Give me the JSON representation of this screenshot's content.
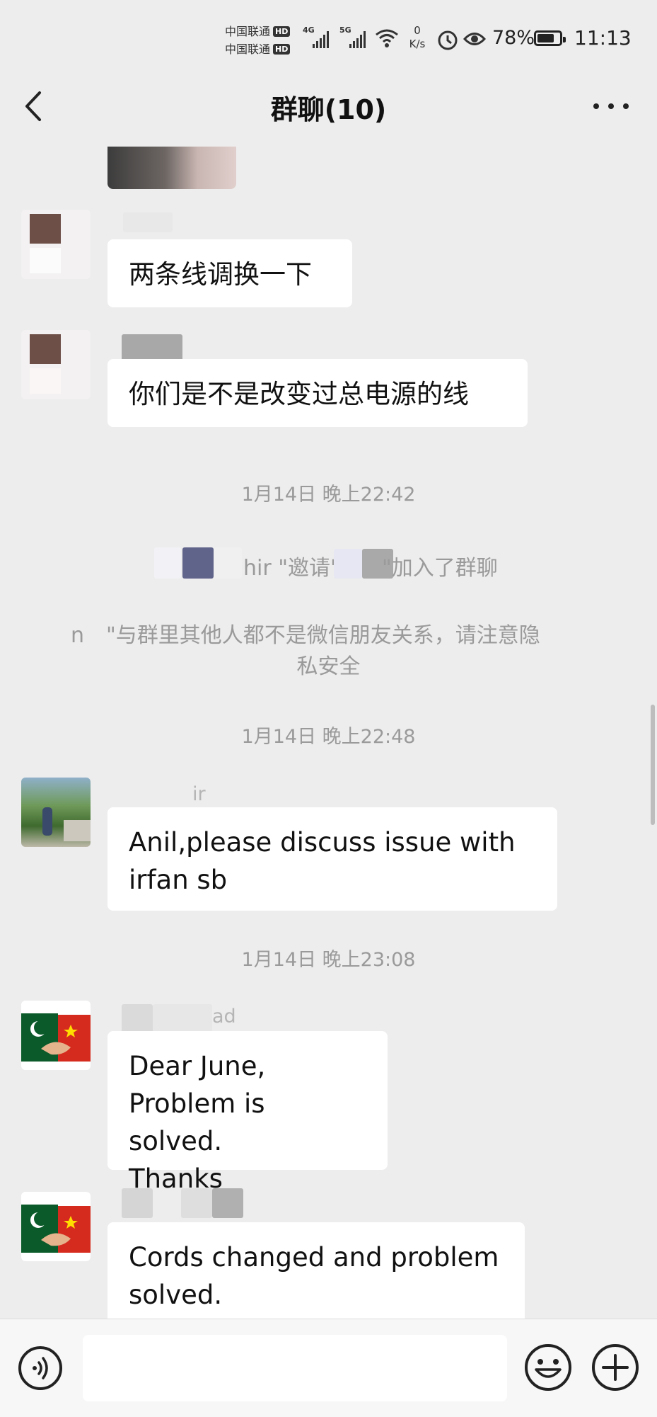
{
  "status_bar": {
    "carrier1": "中国联通",
    "carrier2": "中国联通",
    "hd": "HD",
    "gen1": "4G",
    "gen2": "5G",
    "net_speed_value": "0",
    "net_speed_unit": "K/s",
    "battery_pct": "78%",
    "battery_level": 0.78,
    "time": "11:13"
  },
  "header": {
    "title": "群聊(10)",
    "back_icon": "chevron-left-icon",
    "more_icon": "more-dots-icon"
  },
  "messages": {
    "m1": "两条线调换一下",
    "m2": "你们是不是改变过总电源的线",
    "m3": "Anil,please discuss issue with irfan sb",
    "m4_line1": "Dear June,",
    "m4_line2": "Problem is solved.",
    "m4_line3": "Thanks",
    "m5": "Cords changed and problem solved."
  },
  "timestamps": {
    "t1": "1月14日 晚上22:42",
    "t2": "1月14日 晚上22:48",
    "t3": "1月14日 晚上23:08"
  },
  "system": {
    "invite_frag1": "hir \"邀请\"",
    "invite_frag2": "\"加入了群聊",
    "privacy_frag": "\"与群里其他人都不是微信朋友关系，请注意隐",
    "privacy_line2": "私安全",
    "notice_mark": "n"
  },
  "sender_fragments": {
    "s3": "ir",
    "s4": "ad"
  },
  "input_bar": {
    "voice_icon": "voice-icon",
    "emoji_icon": "emoji-icon",
    "plus_icon": "plus-circle-icon"
  },
  "colors": {
    "background": "#ededed",
    "bubble": "#ffffff",
    "timestamp": "#9a9a9a"
  }
}
